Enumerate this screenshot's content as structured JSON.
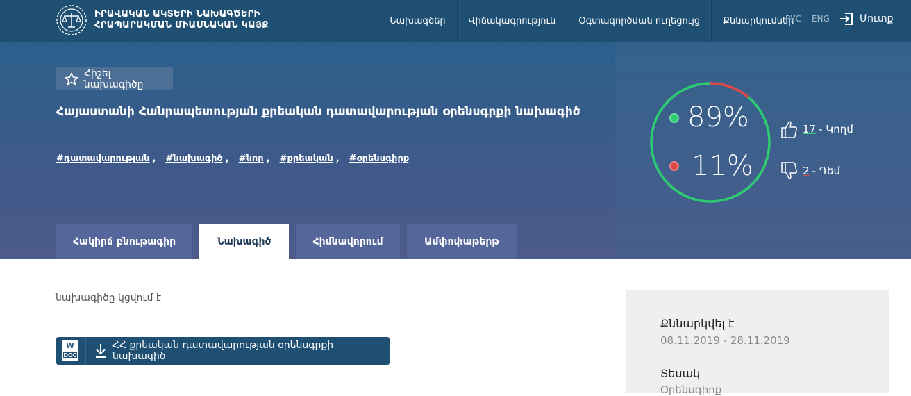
{
  "header": {
    "logo_line1": "ԻՐԱՎԱԿԱՆ ԱԿՏԵՐԻ ՆԱԽԱԳԾԵՐԻ",
    "logo_line2": "ՀՐԱՊԱՐԱԿՄԱՆ ՄԻԱՍՆԱԿԱՆ ԿԱՅՔ",
    "nav": [
      "Նախագծեր",
      "Վիճակագրություն",
      "Օգտագործման ուղեցույց",
      "Քննարկումներ"
    ],
    "lang_ru": "РУС",
    "lang_en": "ENG",
    "login": "Մուտք"
  },
  "hero": {
    "favorite_label": "Հիշել նախագիծը",
    "title": "Հայաստանի Հանրապետության քրեական դատավարության օրենսգրքի նախագիծ",
    "tags": [
      "#դատավարության",
      "#նախագիծ",
      "#նոր",
      "#քրեական",
      "#օրենսգիրք"
    ],
    "tag_separator": ",",
    "tabs": [
      "Հակիրճ բնութագիր",
      "Նախագիծ",
      "Հիմնավորում",
      "Ամփոփաթերթ"
    ],
    "active_tab": 1
  },
  "votes": {
    "for_pct": "89%",
    "against_pct": "11%",
    "for_fraction": 0.89,
    "against_fraction": 0.11,
    "for_count": "17",
    "for_label": "- Կողմ",
    "against_count": "2",
    "against_label": "- Դեմ",
    "colors": {
      "for": "#2ecc71",
      "against": "#e04848"
    }
  },
  "content": {
    "status": "նախագիծը կցվում է",
    "doc_icon_text": "W",
    "doc_icon_sub": "DOC",
    "doc_label": "ՀՀ քրեական դատավարության օրենսգրքի նախագիծ"
  },
  "sidebar": {
    "discussed_label": "Քննարկվել է",
    "discussed_value": "08.11.2019 - 28.11.2019",
    "type_label": "Տեսակ",
    "type_value": "Օրենսգիրք"
  }
}
